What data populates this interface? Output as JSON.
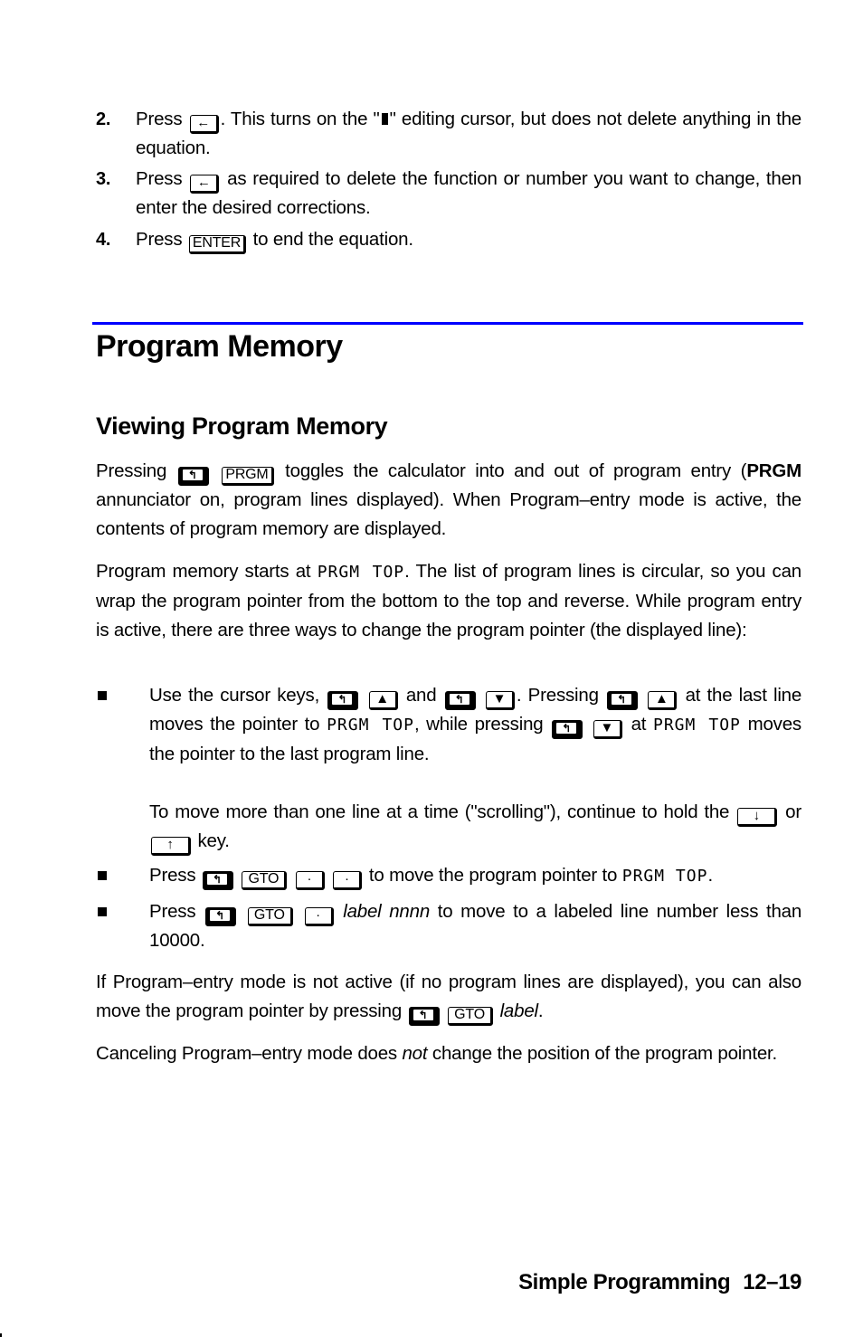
{
  "steps": [
    {
      "number": "2.",
      "parts": {
        "a": "Press",
        "key1_icon": "backspace-arrow-icon",
        "b": ". This turns on the \"",
        "cursor_icon": "editing-cursor-block",
        "c": "\" editing cursor, but does not delete anything in the equation."
      }
    },
    {
      "number": "3.",
      "parts": {
        "a": "Press",
        "key1_icon": "backspace-arrow-icon",
        "b": "as required to delete the function or number you want to change, then enter the desired corrections."
      }
    },
    {
      "number": "4.",
      "parts": {
        "a": "Press",
        "key1": "ENTER",
        "b": "to end the equation."
      }
    }
  ],
  "section": {
    "title": "Program Memory",
    "rule_color": "#0000ff"
  },
  "subsection": {
    "title": "Viewing Program Memory"
  },
  "paragraphs": {
    "p1": {
      "a": "Pressing",
      "key_shift": "shift-left-icon",
      "key_prgm": "PRGM",
      "b": "toggles the calculator into and out of program entry (",
      "bold": "PRGM",
      "c": "annunciator on, program lines displayed). When Program–entry mode is active, the contents of program memory are displayed."
    },
    "p2": {
      "a": "Program memory starts at",
      "lcd": "PRGM TOP",
      "b": ". The list of program lines is circular, so you can wrap the program pointer from the bottom to the top and reverse. While program entry is active, there are three ways to change the program pointer (the displayed line):"
    },
    "p3": {
      "a": "If Program–entry mode is not active (if no program lines are displayed), you can also move the program pointer by pressing",
      "key_gto": "GTO",
      "italic": "label",
      "b": "."
    },
    "p4": {
      "a": "Canceling Program–entry mode does",
      "italic": "not",
      "b": "change the position of the program pointer."
    }
  },
  "bullets": [
    {
      "a": "Use the cursor keys,",
      "up_key": "▲",
      "and": "and",
      "down_key": "▼",
      "b": ". Pressing",
      "c": "at the last line moves the pointer to",
      "lcd": "PRGM TOP",
      "d": ", while pressing",
      "e": "at",
      "f": "moves the pointer to the last program line.",
      "g": "To move more than one line at a time (\"scrolling\"), continue to hold the",
      "down_arrow": "↓",
      "or": "or",
      "up_arrow": "↑",
      "h": "key."
    },
    {
      "a": "Press",
      "key_gto": "GTO",
      "key_dot": "·",
      "b": "to move the program pointer to",
      "lcd": "PRGM TOP",
      "c": "."
    },
    {
      "a": "Press",
      "key_gto": "GTO",
      "key_dot": "·",
      "italic": "label nnnn",
      "b": "to move to a labeled line number less than 10000."
    }
  ],
  "footer": {
    "chapter": "Simple Programming",
    "page": "12–19"
  },
  "glyphs": {
    "backspace": "←",
    "shift": "↰"
  }
}
